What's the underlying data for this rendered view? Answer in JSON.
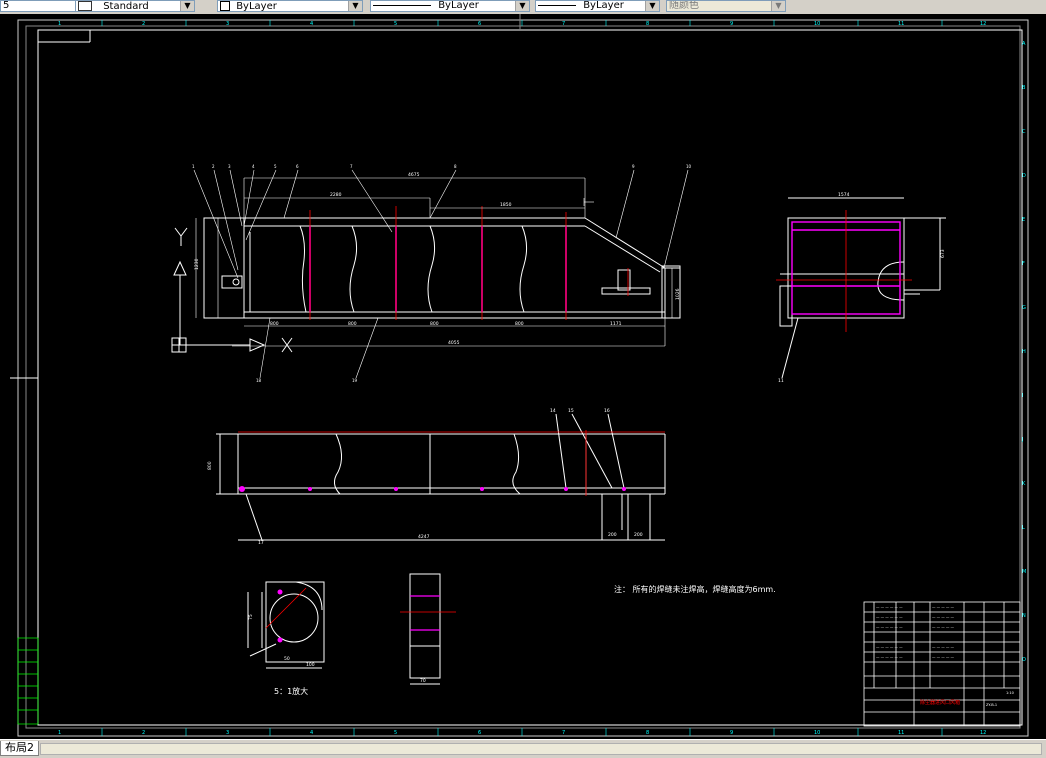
{
  "toolbar": {
    "layer_partial": "5",
    "textstyle": "Standard",
    "color": "ByLayer",
    "linetype": "ByLayer",
    "lineweight": "ByLayer",
    "plotstyle": "随颜色"
  },
  "drawing": {
    "note": "注：   所有的焊缝未注焊高，焊缝高度为6mm.",
    "detail_caption": "5：1放大",
    "dim_top_overall": "4675",
    "dim_top_a": "2280",
    "dim_top_b": "1850",
    "dim_bottom_overall": "4055",
    "dim_seg1": "800",
    "dim_seg2": "800",
    "dim_seg3": "800",
    "dim_seg4": "800",
    "dim_seg5": "1171",
    "dim_height_left": "1230",
    "dim_height_right": "1026",
    "dim_plan_overall": "4247",
    "dim_plan_height": "800",
    "dim_plan_a": "200",
    "dim_plan_b": "200",
    "dim_side_width": "1574",
    "dim_side_h": "673",
    "dim_detail_h": "75",
    "dim_detail_w1": "50",
    "dim_detail_w2": "100",
    "dim_pipe_w": "70",
    "balloons": [
      "1",
      "2",
      "3",
      "4",
      "5",
      "6",
      "7",
      "8",
      "9",
      "10",
      "11",
      "12",
      "13",
      "14",
      "15",
      "16",
      "17",
      "18",
      "19"
    ],
    "grid_cols": [
      "1",
      "2",
      "3",
      "4",
      "5",
      "6",
      "7",
      "8",
      "9",
      "10",
      "11",
      "12"
    ],
    "grid_rows": [
      "A",
      "B",
      "C",
      "D",
      "E",
      "F",
      "G",
      "H",
      "I",
      "J",
      "K",
      "L",
      "M",
      "N",
      "O"
    ]
  },
  "title_block": {
    "drawing_name": "除尘器进风口风箱",
    "drawing_no": "ZY-B-1",
    "scale": "1:10"
  },
  "status": {
    "layout_tab": "布局2"
  },
  "colors": {
    "frame": "#ffffff",
    "dimension": "#ffffff",
    "centerline": "#ff0000",
    "highlight": "#ff00ff",
    "grid_label": "#00ffff",
    "side_label": "#00ff00"
  }
}
